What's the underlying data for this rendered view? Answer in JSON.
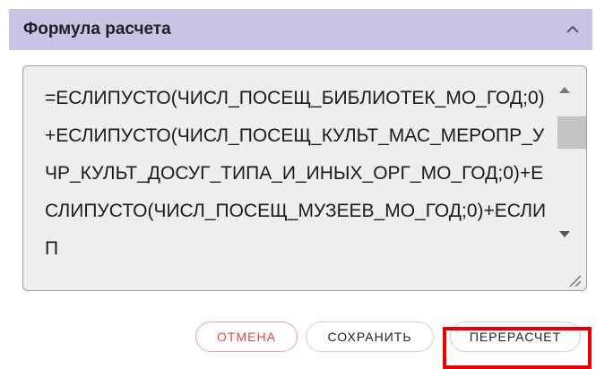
{
  "header": {
    "title": "Формула расчета"
  },
  "formula": {
    "text": "=ЕСЛИПУСТО(ЧИСЛ_ПОСЕЩ_БИБЛИОТЕК_МО_ГОД;0)+ЕСЛИПУСТО(ЧИСЛ_ПОСЕЩ_КУЛЬТ_МАС_МЕРОПР_УЧР_КУЛЬТ_ДОСУГ_ТИПА_И_ИНЫХ_ОРГ_МО_ГОД;0)+ЕСЛИПУСТО(ЧИСЛ_ПОСЕЩ_МУЗЕЕВ_МО_ГОД;0)+ЕСЛИП"
  },
  "actions": {
    "cancel_label": "ОТМЕНА",
    "save_label": "СОХРАНИТЬ",
    "recalc_label": "ПЕРЕРАСЧЕТ"
  },
  "colors": {
    "header_bg": "#c9c3e6",
    "cancel_text": "#d84848",
    "highlight": "#e60000"
  },
  "icons": {
    "collapse": "chevron-up-icon",
    "scroll_up": "triangle-up-icon",
    "scroll_down": "triangle-down-icon",
    "resize": "resize-handle-icon"
  }
}
